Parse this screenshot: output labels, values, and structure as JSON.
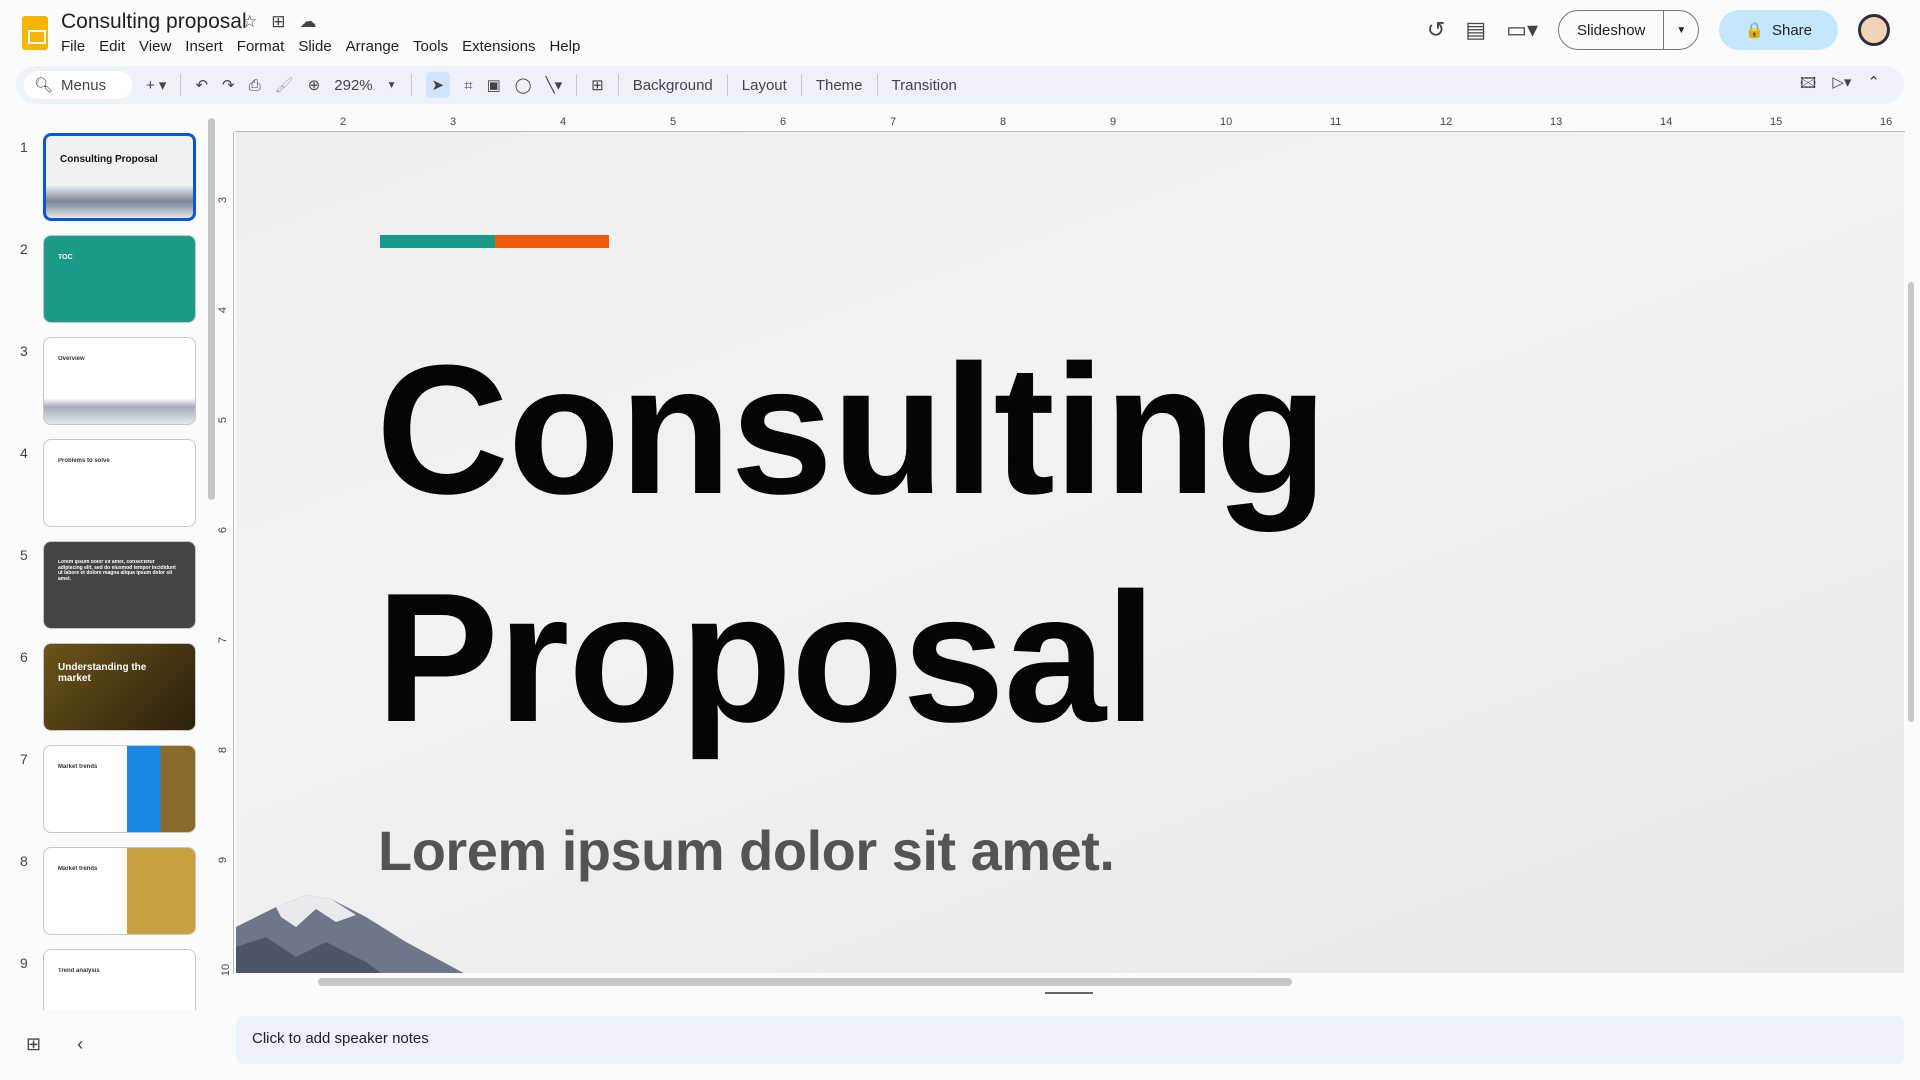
{
  "app": {
    "title": "Consulting proposal",
    "icons": [
      "star-icon",
      "move-folder-icon",
      "cloud-saved-icon"
    ]
  },
  "menu": [
    "File",
    "Edit",
    "View",
    "Insert",
    "Format",
    "Slide",
    "Arrange",
    "Tools",
    "Extensions",
    "Help"
  ],
  "header": {
    "slideshow_label": "Slideshow",
    "share_label": "Share"
  },
  "toolbar": {
    "search_label": "Menus",
    "zoom": "292%",
    "background": "Background",
    "layout": "Layout",
    "theme": "Theme",
    "transition": "Transition"
  },
  "rulers": {
    "top": [
      "2",
      "3",
      "4",
      "5",
      "6",
      "7",
      "8",
      "9",
      "10",
      "11",
      "12",
      "13",
      "14",
      "15",
      "16"
    ],
    "left": [
      "3",
      "4",
      "5",
      "6",
      "7",
      "8",
      "9",
      "10"
    ]
  },
  "slides": [
    {
      "num": "1",
      "title": "Consulting Proposal"
    },
    {
      "num": "2",
      "title": "TOC"
    },
    {
      "num": "3",
      "title": "Overview"
    },
    {
      "num": "4",
      "title": "Problems to solve"
    },
    {
      "num": "5",
      "title": "Lorem ipsum dolor sit amet, consectetur adipiscing elit, sed do eiusmod tempor incididunt ut labore et dolore magna aliqua ipsum dolor sit amet."
    },
    {
      "num": "6",
      "title": "Understanding the market"
    },
    {
      "num": "7",
      "title": "Market trends"
    },
    {
      "num": "8",
      "title": "Market trends"
    },
    {
      "num": "9",
      "title": "Trend analysis"
    }
  ],
  "current_slide": {
    "title_line1": "Consulting",
    "title_line2": "Proposal",
    "subtitle": "Lorem ipsum dolor sit amet.",
    "accent_colors": [
      "#1b9a88",
      "#f05a0a"
    ]
  },
  "notes": {
    "placeholder": "Click to add speaker notes"
  }
}
